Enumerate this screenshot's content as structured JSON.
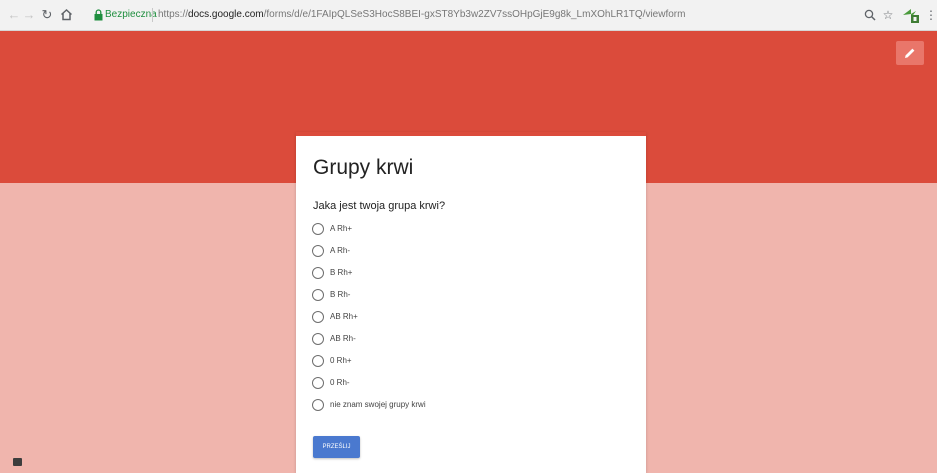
{
  "browser": {
    "back_icon": "back-arrow-icon",
    "forward_icon": "forward-arrow-icon",
    "reload_icon": "reload-icon",
    "home_icon": "home-icon",
    "secure_label": "Bezpieczna",
    "url_scheme": "https://",
    "url_host": "docs.google.com",
    "url_path": "/forms/d/e/1FAIpQLSeS3HocS8BEI-gxST8Yb3w2ZV7ssOHpGjE9g8k_LmXOhLR1TQ/viewform",
    "zoom_icon": "zoom-icon",
    "star_icon": "star-icon",
    "extension_icon": "extension-icon",
    "menu_icon": "more-menu-icon",
    "secure_color": "#1e8e3e"
  },
  "theme": {
    "header_color": "#db4b3b",
    "background_color": "#f0b5ad",
    "button_color": "#4a79cf"
  },
  "form": {
    "title": "Grupy krwi",
    "question": "Jaka jest twoja grupa krwi?",
    "options": [
      "A Rh+",
      "A Rh-",
      "B Rh+",
      "B Rh-",
      "AB Rh+",
      "AB Rh-",
      "0 Rh+",
      "0 Rh-",
      "nie znam swojej grupy krwi"
    ],
    "submit_label": "PRZEŚLIJ"
  },
  "edit_icon": "pencil-icon",
  "feedback_icon": "feedback-icon"
}
